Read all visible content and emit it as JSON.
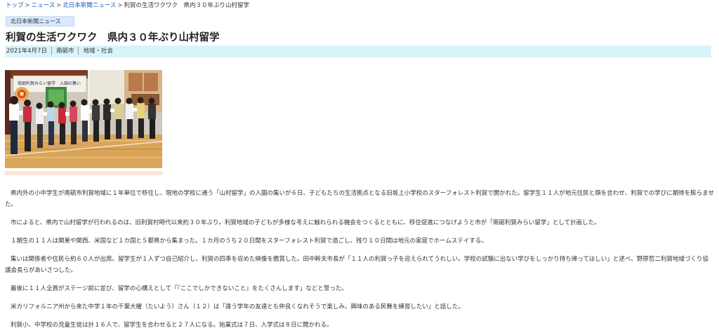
{
  "breadcrumb": {
    "top": "トップ",
    "news": "ニュース",
    "hokunichi": "北日本新聞ニュース",
    "current": "利賀の生活ワクワク　県内３０年ぶり山村留学"
  },
  "category": "北日本新聞ニュース",
  "title": "利賀の生活ワクワク　県内３０年ぶり山村留学",
  "meta": {
    "date": "2021年4月7日",
    "city": "南砺市",
    "section": "地域・社会"
  },
  "photo": {
    "banner_text": "南砺利賀みらい留学　入園の集い"
  },
  "paragraphs": [
    "県内外の小中学生が南砺市利賀地域に１年単位で移住し、現地の学校に通う「山村留学」の入園の集いが６日、子どもたちの生活拠点となる旧坂上小学校のスターフォレスト利賀で開かれた。留学生１１人が地元住民と顔を合わせ、利賀での学びに期待を膨らませた。",
    "市によると、県内で山村留学が行われるのは、旧利賀村時代以来約３０年ぶり。利賀地域の子どもが多様な考えに触れられる機会をつくるとともに、移住促進につなげようと市が「南砺利賀みらい留学」として計画した。",
    "１期生の１１人は関東や関西、米国など１カ国と５都県から集まった。１カ月のうち２０日間をスターフォレスト利賀で過ごし、残り１０日間は地元の家庭でホームステイする。",
    "集いは関係者や住民ら約６０人が出席。留学生が１人ずつ自己紹介し、利賀の四季を収めた映像を鑑賞した。田中幹夫市長が「１１人の利賀っ子を迎えられてうれしい。学校の試験に出ない学びをしっかり持ち帰ってほしい」と述べ、野原哲二利賀地域づくり協議会長らがあいさつした。",
    "最後に１１人全員がステージ前に並び、留学の心構えとして「『ここでしかできないこと』をたくさんします」などと誓った。",
    "米カリフォルニア州から来た中学１年の千葉大耀（たいよう）さん（１２）は「違う学年の友達とも仲良くなれそうで楽しみ。興味のある民舞を練習したい」と話した。",
    "利賀小、中学校の児童生徒は計１６人で、留学生を合わせると２７人になる。始業式は７日、入学式は８日に開かれる。"
  ]
}
